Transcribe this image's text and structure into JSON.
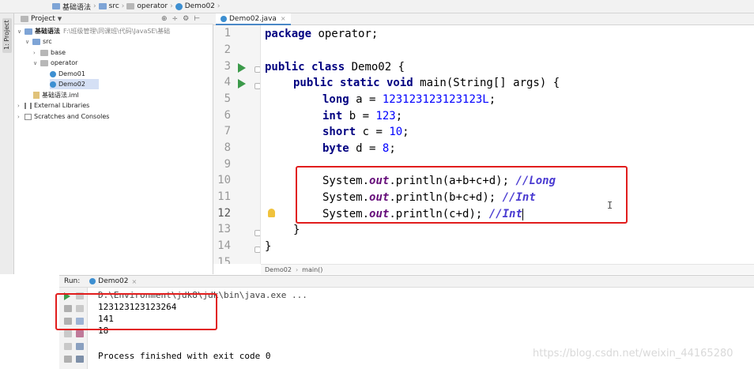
{
  "navbar": {
    "items": [
      "基础语法",
      "src",
      "operator",
      "Demo02"
    ]
  },
  "toolstrip": {
    "project_tab": "1: Project"
  },
  "project_panel": {
    "title": "Project",
    "tools": [
      "⊕",
      "÷",
      "⚙",
      "⊢"
    ],
    "tree": [
      {
        "label": "基础语法",
        "path": "F:\\班级管理\\同课班\\代码\\JavaSE\\基础",
        "level": 0,
        "expanded": true,
        "icon": "folder-icon"
      },
      {
        "label": "src",
        "level": 1,
        "expanded": true,
        "icon": "source-folder-icon"
      },
      {
        "label": "base",
        "level": 2,
        "expanded": false,
        "icon": "package-icon"
      },
      {
        "label": "operator",
        "level": 2,
        "expanded": true,
        "icon": "package-icon"
      },
      {
        "label": "Demo01",
        "level": 3,
        "icon": "class-icon"
      },
      {
        "label": "Demo02",
        "level": 3,
        "icon": "class-icon",
        "selected": true
      },
      {
        "label": "基础语法.iml",
        "level": 1,
        "icon": "iml-file-icon"
      },
      {
        "label": "External Libraries",
        "level": 0,
        "expanded": false,
        "icon": "library-icon"
      },
      {
        "label": "Scratches and Consoles",
        "level": 0,
        "expanded": false,
        "icon": "scratch-icon"
      }
    ]
  },
  "editor": {
    "tab_label": "Demo02.java",
    "line_numbers": [
      "1",
      "2",
      "3",
      "4",
      "5",
      "6",
      "7",
      "8",
      "9",
      "10",
      "11",
      "12",
      "13",
      "14",
      "15"
    ],
    "current_line": "12",
    "lines": {
      "l1": {
        "kw": "package",
        "rest": " operator;"
      },
      "l3": {
        "kw": "public class",
        "rest": " Demo02 {"
      },
      "l4": {
        "kw": "public static void",
        "rest": " main(String[] args) {"
      },
      "l5": {
        "kw": "long",
        "rest": " a = ",
        "num": "123123123123123L",
        "end": ";"
      },
      "l6": {
        "kw": "int",
        "rest": " b = ",
        "num": "123",
        "end": ";"
      },
      "l7": {
        "kw": "short",
        "rest": " c = ",
        "num": "10",
        "end": ";"
      },
      "l8": {
        "kw": "byte",
        "rest": " d = ",
        "num": "8",
        "end": ";"
      },
      "l10": {
        "pre": "System.",
        "field": "out",
        "post": ".println(a+b+c+d); ",
        "cmt": "//Long"
      },
      "l11": {
        "pre": "System.",
        "field": "out",
        "post": ".println(b+c+d); ",
        "cmt": "//Int"
      },
      "l12": {
        "pre": "System.",
        "field": "out",
        "post": ".println(c+d); ",
        "cmt": "//Int"
      },
      "l13": "}",
      "l14": "}"
    },
    "breadcrumb": [
      "Demo02",
      "main()"
    ]
  },
  "run_panel": {
    "label": "Run:",
    "tab_label": "Demo02",
    "cmdline": "D:\\Environment\\jdk8\\jdk\\bin\\java.exe ...",
    "outputs": [
      "123123123123264",
      "141",
      "18"
    ],
    "finish": "Process finished with exit code 0"
  },
  "watermark": "https://blog.csdn.net/weixin_44165280",
  "colors": {
    "annotation": "#e11d1d",
    "keyword": "#000080",
    "number": "#0000ff",
    "comment": "#4a3bd1"
  }
}
